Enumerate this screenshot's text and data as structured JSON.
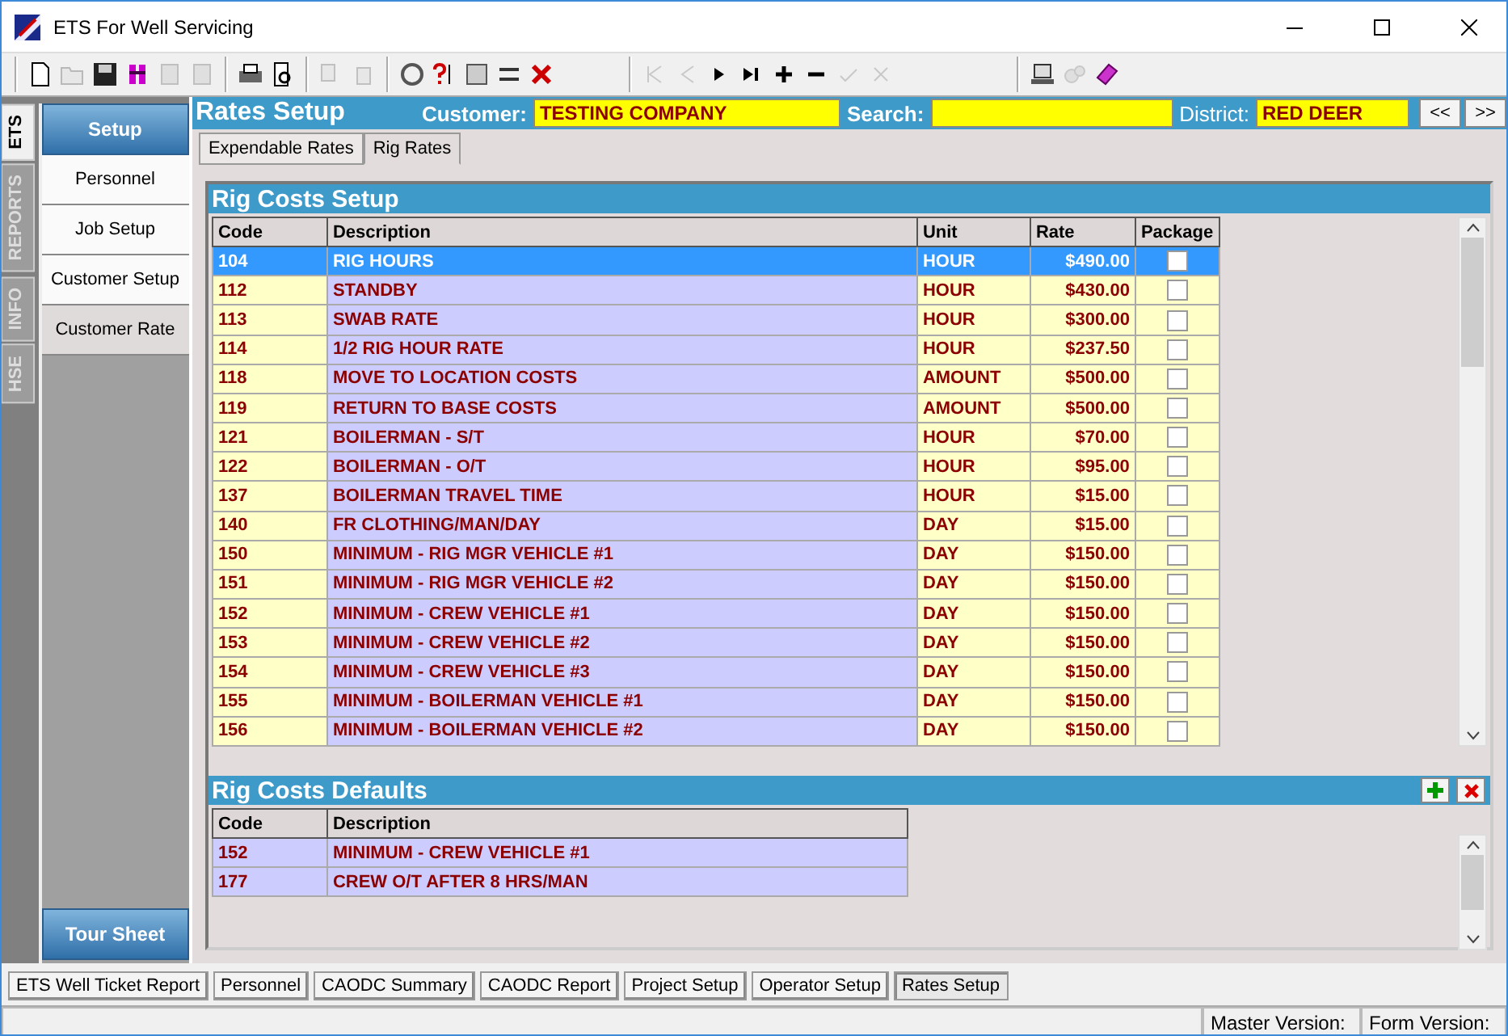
{
  "window": {
    "title": "ETS For Well Servicing"
  },
  "side_tabs": [
    {
      "label": "ETS",
      "selected": true
    },
    {
      "label": "REPORTS",
      "selected": false
    },
    {
      "label": "INFO",
      "selected": false
    },
    {
      "label": "HSE",
      "selected": false
    }
  ],
  "nav": {
    "header": "Setup",
    "items": [
      {
        "label": "Personnel",
        "selected": false
      },
      {
        "label": "Job Setup",
        "selected": false
      },
      {
        "label": "Customer Setup",
        "selected": false
      },
      {
        "label": "Customer Rate",
        "selected": true
      }
    ],
    "footer": "Tour Sheet"
  },
  "form": {
    "title": "Rates Setup",
    "customer_label": "Customer:",
    "customer": "TESTING COMPANY",
    "search_label": "Search:",
    "district_label": "District:",
    "district": "RED DEER",
    "prev": "<<",
    "next": ">>"
  },
  "sub_tabs": [
    {
      "label": "Expendable Rates",
      "selected": false
    },
    {
      "label": "Rig Rates",
      "selected": true
    }
  ],
  "rig_costs": {
    "title": "Rig Costs Setup",
    "columns": [
      "Code",
      "Description",
      "Unit",
      "Rate",
      "Package"
    ],
    "rows": [
      {
        "code": "104",
        "description": "RIG HOURS",
        "unit": "HOUR",
        "rate": "$490.00",
        "package": false,
        "selected": true
      },
      {
        "code": "112",
        "description": "STANDBY",
        "unit": "HOUR",
        "rate": "$430.00",
        "package": false,
        "selected": false
      },
      {
        "code": "113",
        "description": "SWAB RATE",
        "unit": "HOUR",
        "rate": "$300.00",
        "package": false,
        "selected": false
      },
      {
        "code": "114",
        "description": "1/2 RIG HOUR RATE",
        "unit": "HOUR",
        "rate": "$237.50",
        "package": false,
        "selected": false
      },
      {
        "code": "118",
        "description": "MOVE TO LOCATION COSTS",
        "unit": "AMOUNT",
        "rate": "$500.00",
        "package": false,
        "selected": false
      },
      {
        "code": "119",
        "description": "RETURN TO BASE COSTS",
        "unit": "AMOUNT",
        "rate": "$500.00",
        "package": false,
        "selected": false
      },
      {
        "code": "121",
        "description": "BOILERMAN - S/T",
        "unit": "HOUR",
        "rate": "$70.00",
        "package": false,
        "selected": false
      },
      {
        "code": "122",
        "description": "BOILERMAN - O/T",
        "unit": "HOUR",
        "rate": "$95.00",
        "package": false,
        "selected": false
      },
      {
        "code": "137",
        "description": "BOILERMAN TRAVEL TIME",
        "unit": "HOUR",
        "rate": "$15.00",
        "package": false,
        "selected": false
      },
      {
        "code": "140",
        "description": "FR CLOTHING/MAN/DAY",
        "unit": "DAY",
        "rate": "$15.00",
        "package": false,
        "selected": false
      },
      {
        "code": "150",
        "description": "MINIMUM - RIG MGR VEHICLE #1",
        "unit": "DAY",
        "rate": "$150.00",
        "package": false,
        "selected": false
      },
      {
        "code": "151",
        "description": "MINIMUM - RIG MGR VEHICLE #2",
        "unit": "DAY",
        "rate": "$150.00",
        "package": false,
        "selected": false
      },
      {
        "code": "152",
        "description": "MINIMUM - CREW VEHICLE #1",
        "unit": "DAY",
        "rate": "$150.00",
        "package": false,
        "selected": false
      },
      {
        "code": "153",
        "description": "MINIMUM - CREW VEHICLE #2",
        "unit": "DAY",
        "rate": "$150.00",
        "package": false,
        "selected": false
      },
      {
        "code": "154",
        "description": "MINIMUM - CREW VEHICLE #3",
        "unit": "DAY",
        "rate": "$150.00",
        "package": false,
        "selected": false
      },
      {
        "code": "155",
        "description": "MINIMUM - BOILERMAN VEHICLE #1",
        "unit": "DAY",
        "rate": "$150.00",
        "package": false,
        "selected": false
      },
      {
        "code": "156",
        "description": "MINIMUM - BOILERMAN VEHICLE #2",
        "unit": "DAY",
        "rate": "$150.00",
        "package": false,
        "selected": false
      }
    ]
  },
  "rig_defaults": {
    "title": "Rig Costs Defaults",
    "columns": [
      "Code",
      "Description"
    ],
    "rows": [
      {
        "code": "152",
        "description": "MINIMUM - CREW VEHICLE #1"
      },
      {
        "code": "177",
        "description": "CREW O/T AFTER 8 HRS/MAN"
      }
    ]
  },
  "bottom_tabs": [
    {
      "label": "ETS Well Ticket Report",
      "selected": false
    },
    {
      "label": "Personnel",
      "selected": false
    },
    {
      "label": "CAODC Summary",
      "selected": false
    },
    {
      "label": "CAODC Report",
      "selected": false
    },
    {
      "label": "Project Setup",
      "selected": false
    },
    {
      "label": "Operator Setup",
      "selected": false
    },
    {
      "label": "Rates Setup",
      "selected": true
    }
  ],
  "status_bar": {
    "master_version": "Master Version:",
    "form_version": "Form Version:"
  }
}
